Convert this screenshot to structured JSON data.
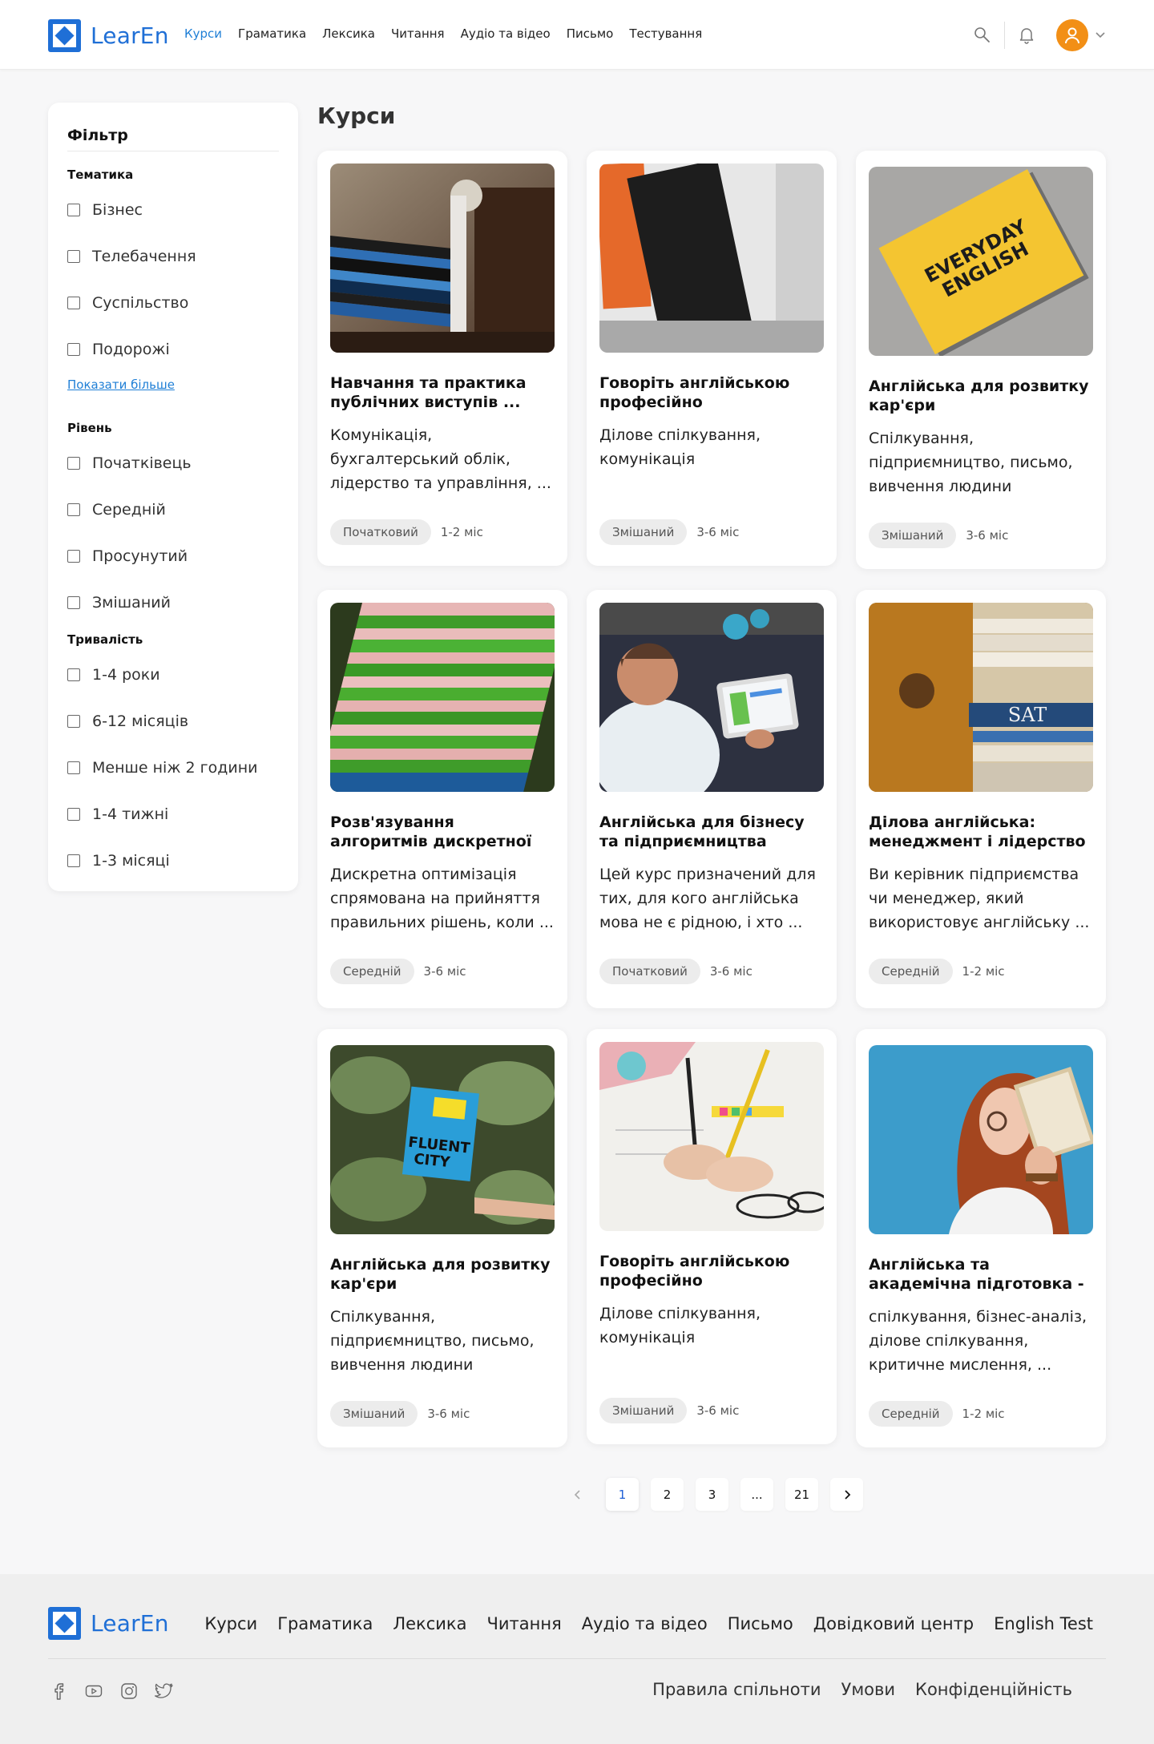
{
  "brand": {
    "name": "LearEn",
    "color": "#1f6fd6"
  },
  "nav": [
    {
      "label": "Курси",
      "active": true
    },
    {
      "label": "Граматика"
    },
    {
      "label": "Лексика"
    },
    {
      "label": "Читання"
    },
    {
      "label": "Аудіо та відео"
    },
    {
      "label": "Письмо"
    },
    {
      "label": "Тестування"
    }
  ],
  "header_icons": [
    "search-icon",
    "bell-icon",
    "user-icon",
    "chevron-down-icon"
  ],
  "filter": {
    "title": "Фільтр",
    "groups": [
      {
        "title": "Тематика",
        "items": [
          "Бізнес",
          "Телебачення",
          "Суспільство",
          "Подорожі"
        ],
        "show_more": "Показати більше"
      },
      {
        "title": "Рівень",
        "items": [
          "Початківець",
          "Середній",
          "Просунутий",
          "Змішаний"
        ]
      },
      {
        "title": "Тривалість",
        "items": [
          "1-4 роки",
          "6-12 місяців",
          "Менше ніж 2 години",
          "1-4 тижні",
          "1-3 місяці"
        ]
      }
    ]
  },
  "page_title": "Курси",
  "courses": [
    {
      "title": "Навчання та практика публічних виступів ...",
      "desc": "Комунікація, бухгалтерський облік, лідерство та управління, ...",
      "level": "Початковий",
      "duration": "1-2 міс",
      "image": "books-on-shelf"
    },
    {
      "title": "Говоріть англійською професійно",
      "desc": "Ділове спілкування, комунікація",
      "level": "Змішаний",
      "duration": "3-6 міс",
      "image": "black-book-orange-book"
    },
    {
      "title": "Англійська для розвитку кар'єри",
      "desc": "Спілкування, підприємництво, письмо, вивчення людини",
      "level": "Змішаний",
      "duration": "3-6 міс",
      "image": "everyday-english-book"
    },
    {
      "title": "Розв'язування алгоритмів дискретної оптимізації",
      "desc": "Дискретна оптимізація спрямована на прийняття правильних рішень, коли ...",
      "level": "Середній",
      "duration": "3-6 міс",
      "image": "green-books-stack"
    },
    {
      "title": "Англійська для бізнесу та підприємництва",
      "desc": "Цей курс призначений для тих, для кого англійська мова не є рідною, і хто ...",
      "level": "Початковий",
      "duration": "3-6 міс",
      "image": "child-with-tablet"
    },
    {
      "title": "Ділова англійська: менеджмент і лідерство",
      "desc": "Ви керівник підприємства чи менеджер, який використовує англійську ...",
      "level": "Середній",
      "duration": "1-2 міс",
      "image": "sat-book-stack"
    },
    {
      "title": "Англійська для розвитку кар'єри",
      "desc": "Спілкування, підприємництво, письмо, вивчення людини",
      "level": "Змішаний",
      "duration": "3-6 міс",
      "image": "fluent-city-notebook"
    },
    {
      "title": "Говоріть англійською професійно",
      "desc": "Ділове спілкування, комунікація",
      "level": "Змішаний",
      "duration": "3-6 міс",
      "image": "writing-hands"
    },
    {
      "title": "Англійська та академічна підготовка - Pre-Collegiate",
      "desc": "спілкування, бізнес-аналіз, ділове спілкування, критичне мислення, ...",
      "level": "Середній",
      "duration": "1-2 міс",
      "image": "woman-reading"
    }
  ],
  "pagination": {
    "prev": "‹",
    "pages": [
      "1",
      "2",
      "3",
      "...",
      "21"
    ],
    "next": "›",
    "current": "1"
  },
  "footer": {
    "nav": [
      "Курси",
      "Граматика",
      "Лексика",
      "Читання",
      "Аудіо та відео",
      "Письмо",
      "Довідковий центр",
      "English Test"
    ],
    "social": [
      "facebook-icon",
      "youtube-icon",
      "instagram-icon",
      "twitter-icon"
    ],
    "legal": [
      "Правила спільноти",
      "Умови",
      "Конфіденційність"
    ]
  }
}
